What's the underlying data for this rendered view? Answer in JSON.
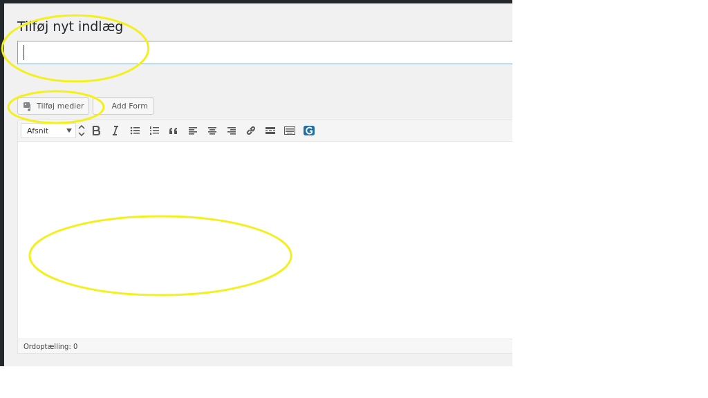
{
  "page_title": "Tilføj nyt indlæg",
  "title_field": {
    "focused": true
  },
  "media_buttons": [
    {
      "kind": "media",
      "label": "Tilføj medier"
    },
    {
      "kind": "plain",
      "label": "Add Form"
    }
  ],
  "toolbar": {
    "format": "Afsnit",
    "buttons": [
      {
        "kind": "bold"
      },
      {
        "kind": "italic"
      },
      {
        "kind": "bullets"
      },
      {
        "kind": "numbers"
      },
      {
        "kind": "quote"
      },
      {
        "kind": "align-left"
      },
      {
        "kind": "align-center"
      },
      {
        "kind": "align-right"
      },
      {
        "kind": "link"
      },
      {
        "kind": "more"
      },
      {
        "kind": "keyboard"
      },
      {
        "kind": "g-logo"
      }
    ]
  },
  "status_bar": "Ordoptælling: 0",
  "highlights": [
    {
      "kind": "title"
    },
    {
      "kind": "media"
    },
    {
      "kind": "editor"
    }
  ]
}
